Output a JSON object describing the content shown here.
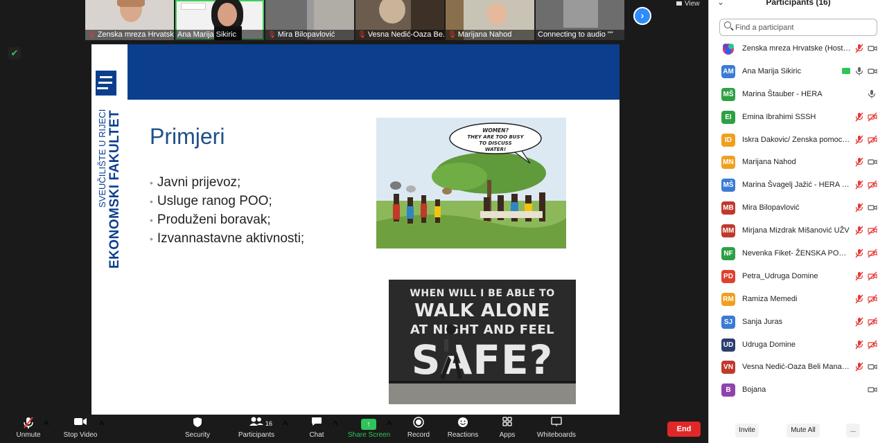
{
  "gallery": {
    "tiles": [
      {
        "name": "Zenska mreza Hrvatske",
        "muted": true
      },
      {
        "name": "Ana Marija Sikiric",
        "muted": false
      },
      {
        "name": "Mira Bilopavlović",
        "muted": true
      },
      {
        "name": "Vesna Nedić-Oaza Be...",
        "muted": true
      },
      {
        "name": "Marijana Nahod",
        "muted": true
      },
      {
        "name": "Connecting to audio \"\"",
        "muted": false
      }
    ],
    "view_label": "View"
  },
  "slide": {
    "vertical_line1": "SVEUČILIŠTE U RIJECI",
    "vertical_line2": "EKONOMSKI FAKULTET",
    "title": "Primjeri",
    "bullets": [
      "Javni prijevoz;",
      "Usluge ranog POO;",
      "Produženi boravak;",
      "Izvannastavne aktivnosti;"
    ],
    "cartoon_bubble": [
      "WOMEN?",
      "THEY ARE TOO BUSY",
      "TO DISCUSS",
      "WATER!"
    ],
    "poster_lines": [
      "WHEN WILL I BE ABLE TO",
      "WALK ALONE",
      "AT NIGHT AND FEEL",
      "SAFE?"
    ]
  },
  "toolbar": {
    "unmute": "Unmute",
    "stop_video": "Stop Video",
    "security": "Security",
    "participants": "Participants",
    "participants_count": "16",
    "chat": "Chat",
    "share_screen": "Share Screen",
    "record": "Record",
    "reactions": "Reactions",
    "apps": "Apps",
    "whiteboards": "Whiteboards",
    "end": "End"
  },
  "panel": {
    "title": "Participants (16)",
    "search_placeholder": "Find a participant",
    "participants": [
      {
        "initials": "",
        "name": "Zenska mreza Hrvatske (Host, me)",
        "color": "#8e44ad",
        "mic": "muted",
        "cam": "on",
        "host": true
      },
      {
        "initials": "AM",
        "name": "Ana Marija Sikiric",
        "color": "#3a7bd5",
        "mic": "on",
        "cam": "on",
        "sharing": true
      },
      {
        "initials": "MŠ",
        "name": "Marina Štauber - HERA",
        "color": "#2ea043",
        "mic": "on",
        "cam": "none"
      },
      {
        "initials": "EI",
        "name": "Emina Ibrahimi SSSH",
        "color": "#2ea043",
        "mic": "muted",
        "cam": "off"
      },
      {
        "initials": "ID",
        "name": "Iskra Dakovic/ Zenska pomoc sa...",
        "color": "#f0a020",
        "mic": "muted",
        "cam": "off"
      },
      {
        "initials": "MN",
        "name": "Marijana Nahod",
        "color": "#f0a020",
        "mic": "muted",
        "cam": "on"
      },
      {
        "initials": "MŠ",
        "name": "Marina Švagelj Jažić - HERA Križ...",
        "color": "#3a7bd5",
        "mic": "muted",
        "cam": "off"
      },
      {
        "initials": "MB",
        "name": "Mira Bilopavlović",
        "color": "#c0392b",
        "mic": "muted",
        "cam": "on"
      },
      {
        "initials": "MM",
        "name": "Mirjana Mizdrak Mišanović UŽV",
        "color": "#c0392b",
        "mic": "muted",
        "cam": "off"
      },
      {
        "initials": "NF",
        "name": "Nevenka Fiket- ŽENSKA POMOĆ...",
        "color": "#2ea043",
        "mic": "muted",
        "cam": "off"
      },
      {
        "initials": "PD",
        "name": "Petra_Udruga Domine",
        "color": "#e04030",
        "mic": "muted",
        "cam": "off"
      },
      {
        "initials": "RM",
        "name": "Ramiza Memedi",
        "color": "#f0a020",
        "mic": "muted",
        "cam": "off"
      },
      {
        "initials": "SJ",
        "name": "Sanja Juras",
        "color": "#3a7bd5",
        "mic": "muted",
        "cam": "off"
      },
      {
        "initials": "UD",
        "name": "Udruga Domine",
        "color": "#2c3e70",
        "mic": "muted",
        "cam": "off"
      },
      {
        "initials": "VN",
        "name": "Vesna Nedić-Oaza Beli Manastir",
        "color": "#c0392b",
        "mic": "muted",
        "cam": "on"
      },
      {
        "initials": "B",
        "name": "Bojana",
        "color": "#8e44ad",
        "mic": "none",
        "cam": "on"
      }
    ],
    "footer": {
      "invite": "Invite",
      "mute_all": "Mute All",
      "more": "..."
    }
  }
}
